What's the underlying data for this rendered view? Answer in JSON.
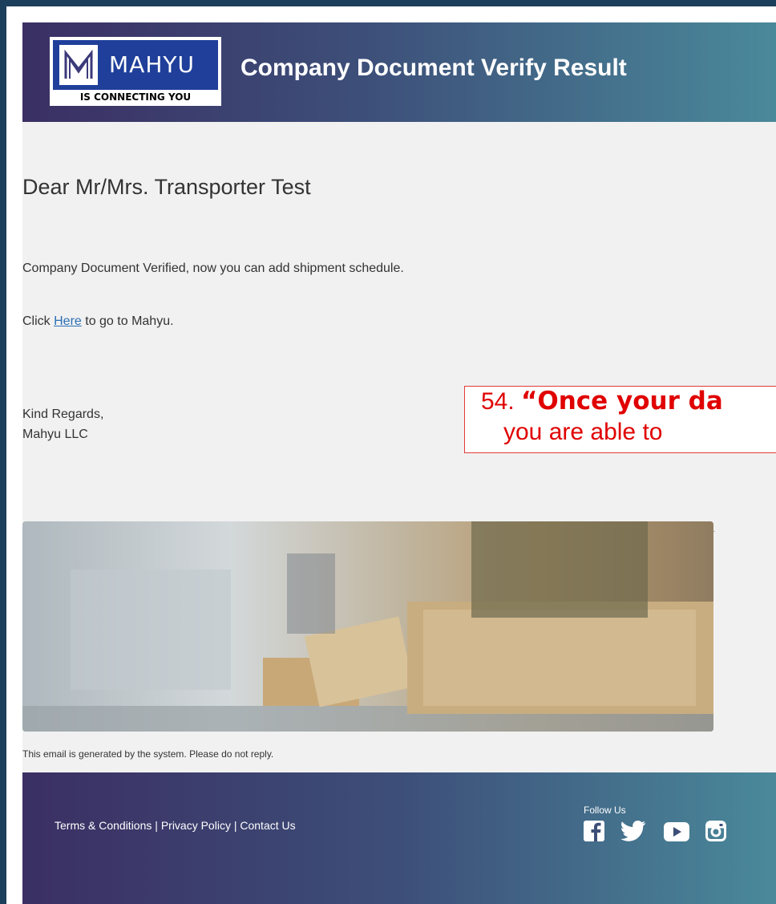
{
  "header": {
    "logo_name": "MAHYU",
    "logo_tagline": "IS CONNECTING YOU",
    "title": "Company Document Verify Result"
  },
  "body": {
    "greeting": "Dear Mr/Mrs. Transporter Test",
    "message": "Company Document Verified, now you can add shipment schedule.",
    "click_prefix": "Click ",
    "click_link": "Here",
    "click_suffix": " to go to Mahyu.",
    "regards": "Kind Regards,",
    "signature": "Mahyu LLC"
  },
  "footnote": "This email is generated by the system. Please do not reply.",
  "footer": {
    "terms": "Terms & Conditions",
    "privacy": "Privacy Policy",
    "contact": "Contact Us",
    "separator": " | ",
    "follow_label": "Follow Us",
    "social_icons": [
      "facebook-icon",
      "twitter-icon",
      "youtube-icon",
      "instagram-icon"
    ]
  },
  "callout": {
    "number": "54.",
    "bold_text": "“Once your da",
    "line2": "you are able to"
  },
  "colors": {
    "header_gradient_start": "#3b2f63",
    "header_gradient_end": "#4a8a9b",
    "logo_blue": "#1f3f9a",
    "link": "#2b6fb5",
    "callout_red": "#e00000",
    "frame": "#1c3f5c"
  }
}
